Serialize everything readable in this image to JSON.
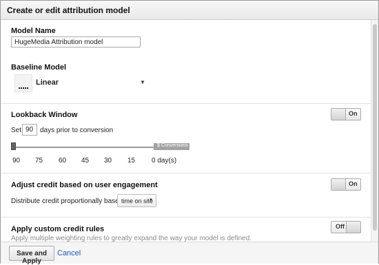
{
  "dialog": {
    "title": "Create or edit attribution model"
  },
  "model_name": {
    "label": "Model Name",
    "value": "HugeMedia Attribution model"
  },
  "baseline": {
    "label": "Baseline Model",
    "selected": "Linear",
    "icon": "linear-model-icon"
  },
  "lookback": {
    "title": "Lookback Window",
    "toggle": "On",
    "set_label": "Set",
    "days_value": "90",
    "suffix": "days prior to conversion",
    "slider_label": "$ Conversions",
    "slider_level_days": 90,
    "ticks": [
      "90",
      "75",
      "60",
      "45",
      "30",
      "15",
      "0 day(s)"
    ]
  },
  "engagement": {
    "title": "Adjust credit based on user engagement",
    "toggle": "On",
    "distribute_label": "Distribute credit proportionally based on",
    "select_value": "time on site"
  },
  "custom": {
    "title": "Apply custom credit rules",
    "toggle": "Off",
    "description": "Apply multiple weighting rules to greatly expand the way your model is defined."
  },
  "footer": {
    "save": "Save and Apply",
    "cancel": "Cancel"
  }
}
